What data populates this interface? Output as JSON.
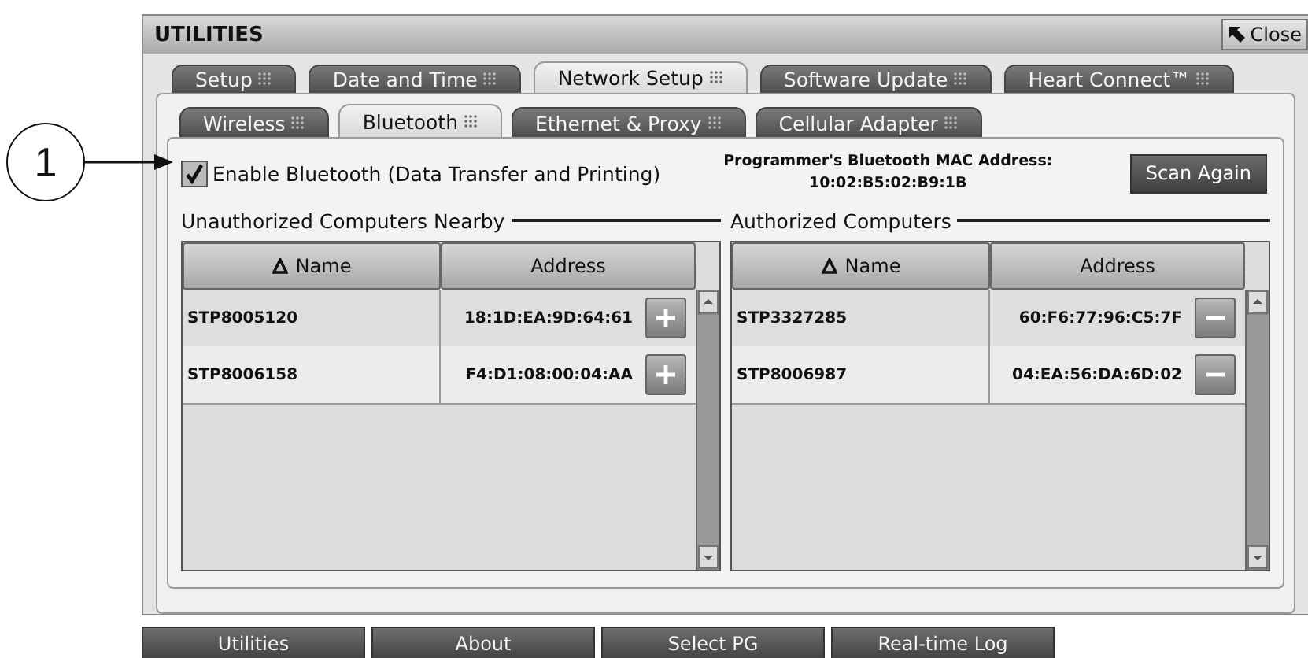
{
  "window": {
    "title": "UTILITIES",
    "close_button": "Close"
  },
  "callout": {
    "number": "1"
  },
  "main_tabs": [
    {
      "label": "Setup",
      "selected": false
    },
    {
      "label": "Date and Time",
      "selected": false
    },
    {
      "label": "Network Setup",
      "selected": true
    },
    {
      "label": "Software Update",
      "selected": false
    },
    {
      "label": "Heart Connect™",
      "selected": false
    }
  ],
  "sub_tabs": [
    {
      "label": "Wireless",
      "selected": false
    },
    {
      "label": "Bluetooth",
      "selected": true
    },
    {
      "label": "Ethernet & Proxy",
      "selected": false
    },
    {
      "label": "Cellular Adapter",
      "selected": false
    }
  ],
  "enable_bluetooth": {
    "label": "Enable Bluetooth (Data Transfer and Printing)",
    "checked": true
  },
  "mac_address": {
    "label": "Programmer's Bluetooth MAC Address:",
    "value": "10:02:B5:02:B9:1B"
  },
  "scan_button": "Scan Again",
  "tables": [
    {
      "title": "Unauthorized Computers Nearby",
      "columns": [
        {
          "label": "Name",
          "sorted": true
        },
        {
          "label": "Address",
          "sorted": false
        }
      ],
      "rows": [
        {
          "name": "STP8005120",
          "address": "18:1D:EA:9D:64:61",
          "kind": "add"
        },
        {
          "name": "STP8006158",
          "address": "F4:D1:08:00:04:AA",
          "kind": "add"
        }
      ]
    },
    {
      "title": "Authorized Computers",
      "columns": [
        {
          "label": "Name",
          "sorted": true
        },
        {
          "label": "Address",
          "sorted": false
        }
      ],
      "rows": [
        {
          "name": "STP3327285",
          "address": "60:F6:77:96:C5:7F",
          "kind": "remove"
        },
        {
          "name": "STP8006987",
          "address": "04:EA:56:DA:6D:02",
          "kind": "remove"
        }
      ]
    }
  ],
  "bottom_nav": [
    {
      "label": "Utilities"
    },
    {
      "label": "About"
    },
    {
      "label": "Select PG"
    },
    {
      "label": "Real-time Log"
    }
  ]
}
